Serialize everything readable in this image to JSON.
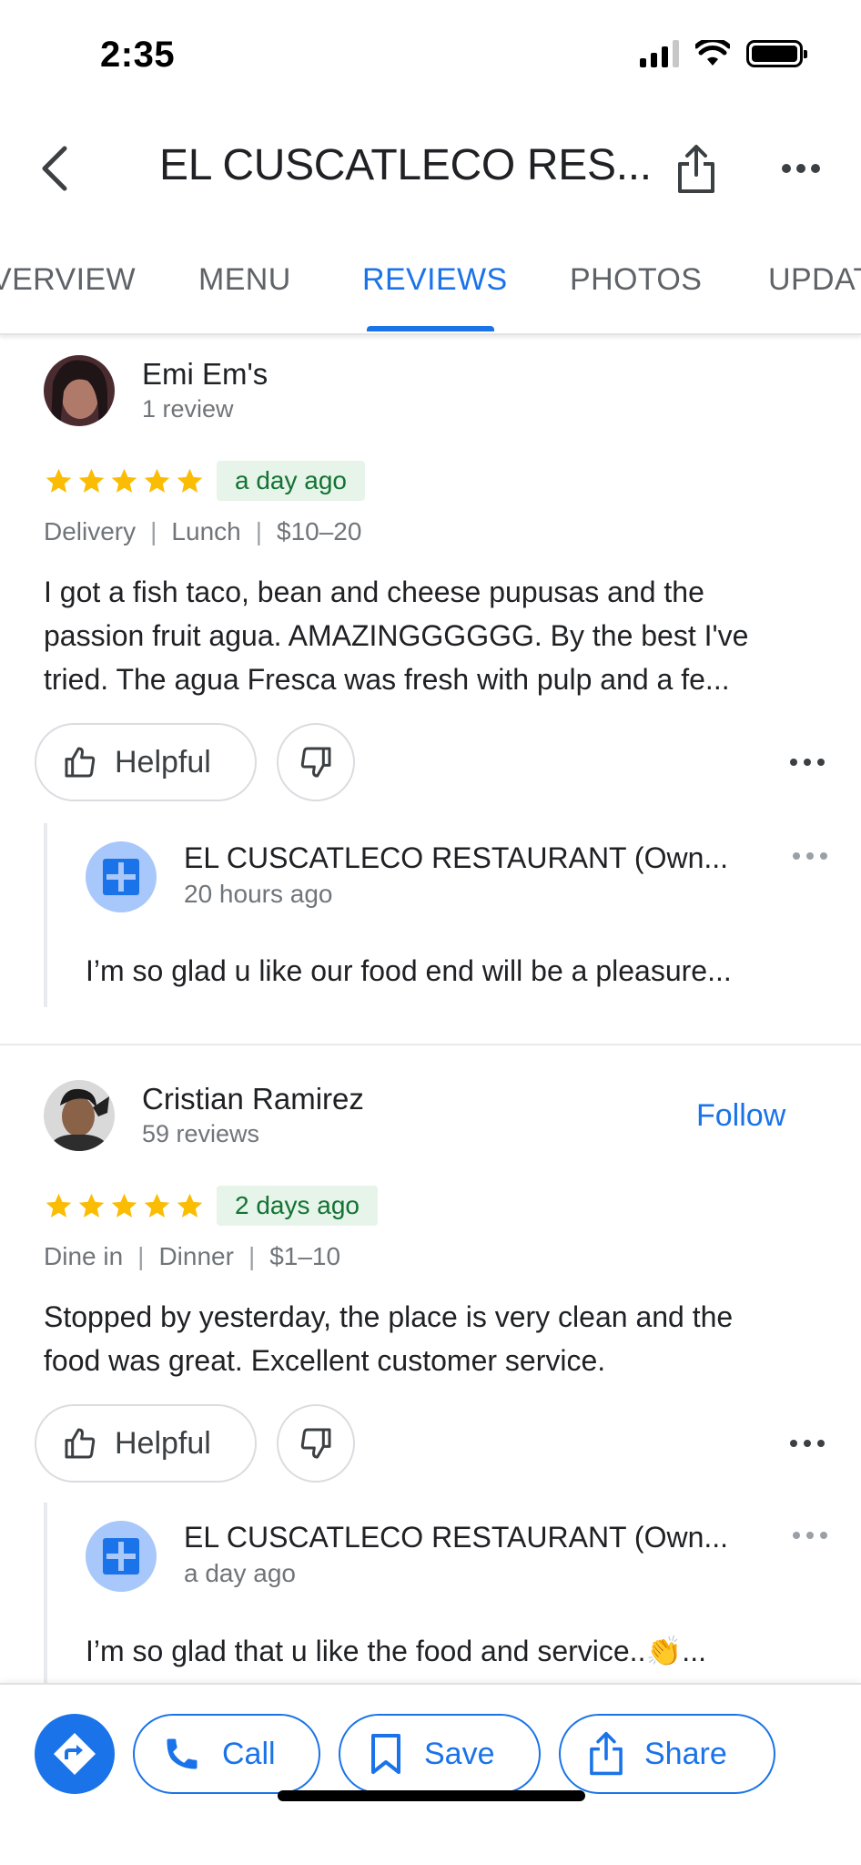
{
  "status_bar": {
    "time": "2:35"
  },
  "header": {
    "title": "EL CUSCATLECO RES..."
  },
  "tabs": [
    {
      "label": "VERVIEW",
      "active": false
    },
    {
      "label": "MENU",
      "active": false
    },
    {
      "label": "REVIEWS",
      "active": true
    },
    {
      "label": "PHOTOS",
      "active": false
    },
    {
      "label": "UPDAT",
      "active": false
    }
  ],
  "reviews": [
    {
      "name": "Emi Em's",
      "sub": "1 review",
      "rating": 5,
      "date": "a day ago",
      "meta": [
        "Delivery",
        "Lunch",
        "$10–20"
      ],
      "text": [
        "I got a fish taco, bean and cheese pupusas and the",
        "passion fruit agua. AMAZINGGGGGG. By the best I've",
        "tried. The agua Fresca was fresh with pulp and a fe..."
      ],
      "helpful_label": "Helpful",
      "owner_reply": {
        "name": "EL CUSCATLECO RESTAURANT (Own...",
        "time": "20 hours ago",
        "text": "I’m so glad u like our food end will be a pleasure..."
      }
    },
    {
      "name": "Cristian Ramirez",
      "sub": "59 reviews",
      "follow_label": "Follow",
      "rating": 5,
      "date": "2 days ago",
      "meta": [
        "Dine in",
        "Dinner",
        "$1–10"
      ],
      "text": [
        "Stopped by yesterday, the place is very clean and the",
        "food was great. Excellent customer service."
      ],
      "helpful_label": "Helpful",
      "owner_reply": {
        "name": "EL CUSCATLECO RESTAURANT (Own...",
        "time": "a day ago",
        "text": "I’m so glad that u like the food and service..👏..."
      }
    }
  ],
  "bottom_bar": {
    "call_label": "Call",
    "save_label": "Save",
    "share_label": "Share"
  },
  "colors": {
    "accent": "#1a73e8",
    "star": "#fbbc04",
    "date_badge_bg": "#e6f4ea",
    "date_badge_text": "#137333"
  },
  "icons": [
    "back-icon",
    "share-icon",
    "more-icon",
    "star-icon",
    "thumbs-up-icon",
    "thumbs-down-icon",
    "directions-icon",
    "phone-icon",
    "bookmark-icon"
  ]
}
